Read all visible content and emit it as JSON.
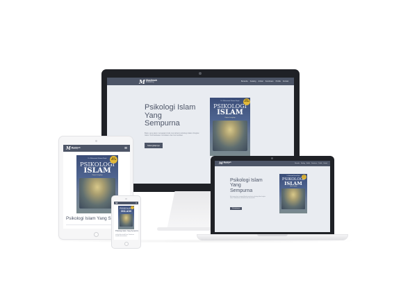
{
  "site": {
    "logo_mark": "M",
    "logo_name": "Muslimah",
    "logo_sub": "Publishing",
    "menu": [
      "Beranda",
      "Katalog",
      "Artikel",
      "Kemitraan",
      "Profile",
      "Kontak"
    ],
    "hero_title_lines": [
      "Psikologi Islam",
      "Yang",
      "Sempurna"
    ],
    "hero_title_oneline": "Psikologi Islam Yang Sempurna",
    "hero_desc": "Buku yang akan mengajak Anda memahami psikologi dalam bingkai Islam. Pembahasan mendalam dan bermanfaat.",
    "hero_button": "Selengkapnya",
    "hamburger_icon": "≡"
  },
  "book": {
    "author": "Dr. Muhammad Utsman Najati",
    "title_1": "PSIKOLOGI",
    "title_2": "ISLAM",
    "subtitle": "Kajian Lengkap",
    "badge": "BEST SELLER"
  },
  "colors": {
    "nav": "#4d5567",
    "accent": "#4d5567",
    "badge": "#e2b93b",
    "bezel": "#1f2126"
  }
}
